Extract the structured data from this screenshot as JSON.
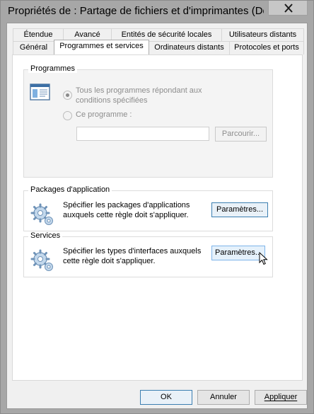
{
  "window": {
    "title": "Propriétés de : Partage de fichiers et d'imprimantes (Dema..."
  },
  "tabs_row1": [
    {
      "label": "Étendue"
    },
    {
      "label": "Avancé"
    },
    {
      "label": "Entités de sécurité locales"
    },
    {
      "label": "Utilisateurs distants"
    }
  ],
  "tabs_row2": [
    {
      "label": "Général"
    },
    {
      "label": "Programmes et services",
      "active": true
    },
    {
      "label": "Ordinateurs distants"
    },
    {
      "label": "Protocoles et ports"
    }
  ],
  "programmes": {
    "label": "Programmes",
    "option_all_line1": "Tous les programmes répondant aux",
    "option_all_line2": "conditions spécifiées",
    "option_this": "Ce programme :",
    "path_value": "",
    "browse_button": "Parcourir..."
  },
  "app_packages": {
    "label": "Packages d'application",
    "description_line1": "Spécifier les packages d'applications",
    "description_line2": "auxquels cette règle doit s'appliquer.",
    "settings_button": "Paramètres..."
  },
  "services": {
    "label": "Services",
    "description_line1": "Spécifier les types d'interfaces auxquels",
    "description_line2": "cette règle doit s'appliquer.",
    "settings_button": "Paramètres..."
  },
  "footer": {
    "ok": "OK",
    "cancel": "Annuler",
    "apply": "Appliquer"
  },
  "icons": {
    "program": "program-window-icon",
    "gear": "gear-icon",
    "close": "close-icon",
    "cursor": "mouse-cursor-icon"
  },
  "colors": {
    "titlebar": "#a7a7a7",
    "close_button": "#c7c7c7",
    "dialog_bg": "#f0f0f0",
    "focus_border": "#3c7fb1",
    "hover_border": "#7eb4ea"
  }
}
